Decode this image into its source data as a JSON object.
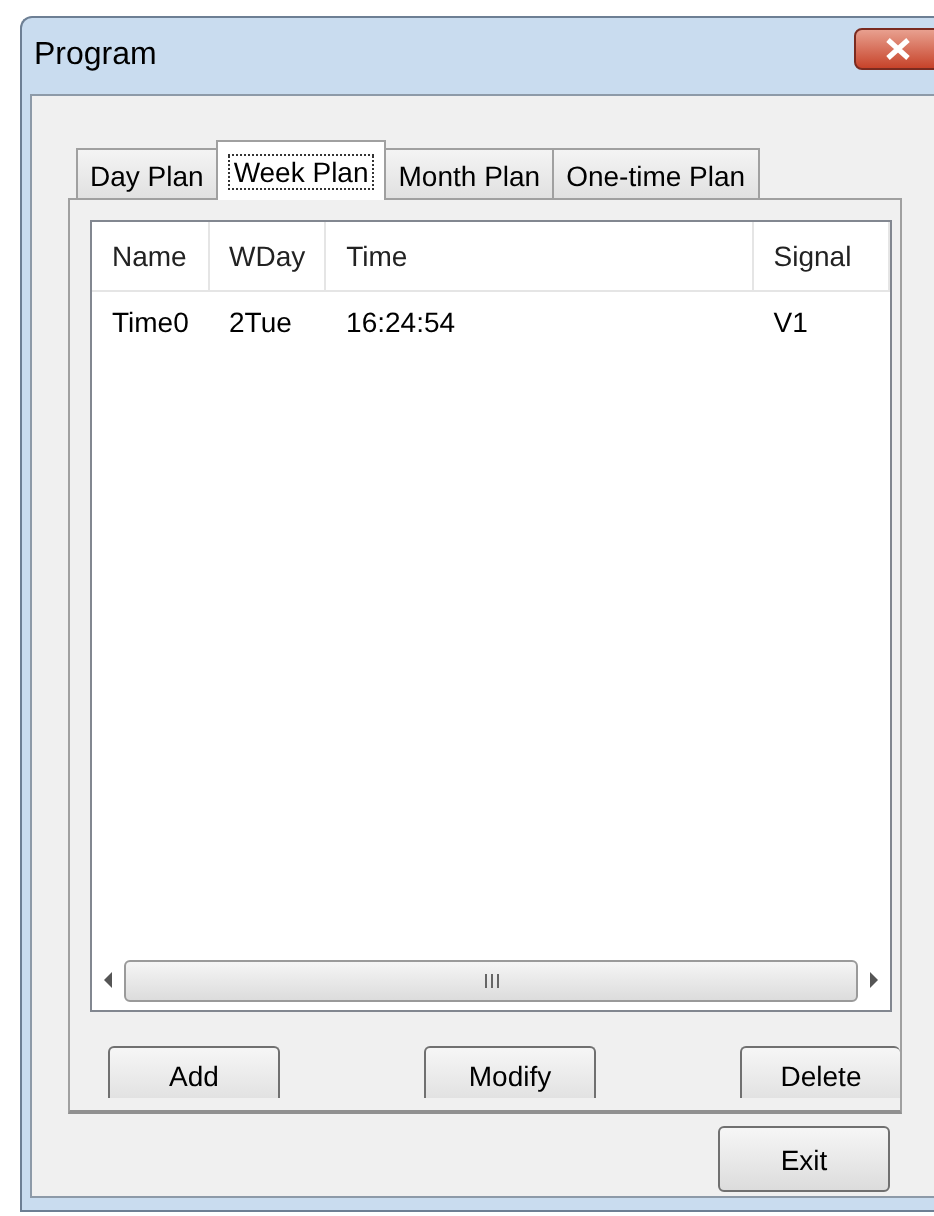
{
  "window": {
    "title": "Program"
  },
  "tabs": [
    {
      "label": "Day Plan",
      "selected": false
    },
    {
      "label": "Week Plan",
      "selected": true
    },
    {
      "label": "Month Plan",
      "selected": false
    },
    {
      "label": "One-time Plan",
      "selected": false
    }
  ],
  "table": {
    "columns": [
      "Name",
      "WDay",
      "Time",
      "Signal"
    ],
    "rows": [
      [
        "Time0",
        "2Tue",
        "16:24:54",
        "V1"
      ]
    ]
  },
  "panel_buttons": [
    "Add",
    "Modify",
    "Delete"
  ],
  "exit_button": "Exit"
}
